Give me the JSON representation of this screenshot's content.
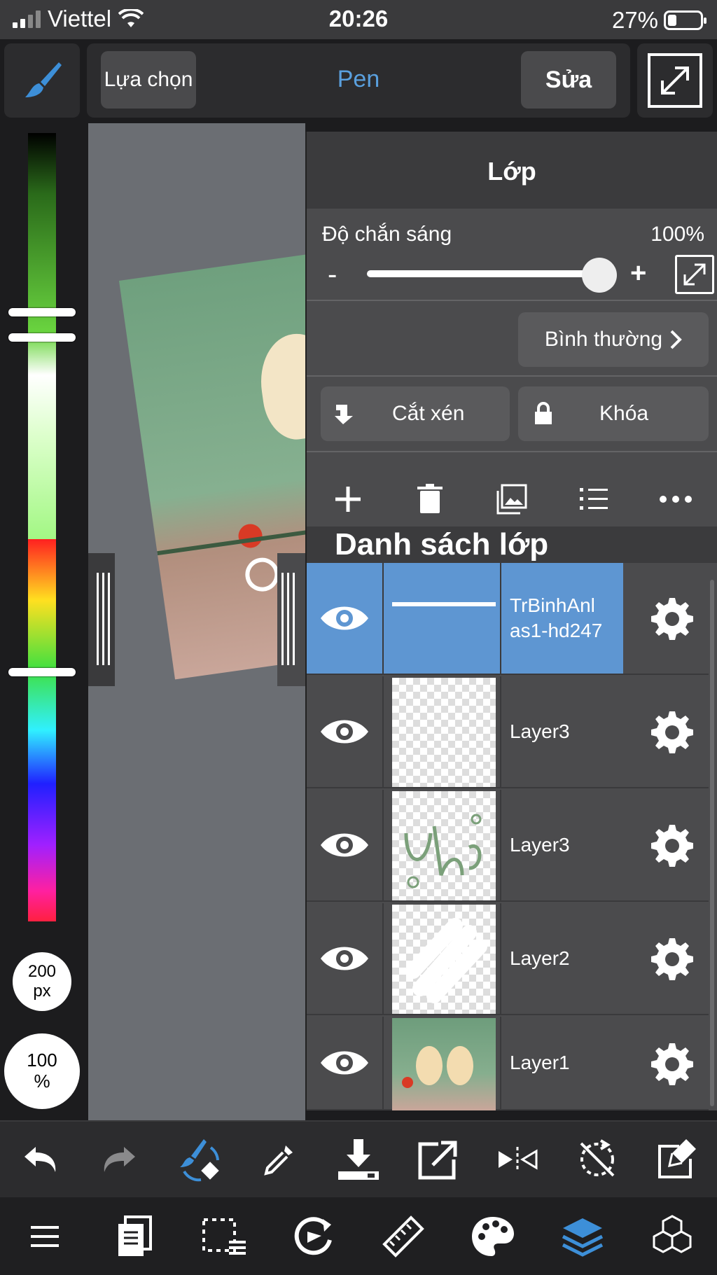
{
  "status_bar": {
    "carrier": "Viettel",
    "time": "20:26",
    "battery": "27%"
  },
  "toolbar": {
    "select_label": "Lựa chọn",
    "tool_name": "Pen",
    "edit_label": "Sửa"
  },
  "color_panel": {
    "brush_size_value": "200",
    "brush_size_unit": "px",
    "brush_opacity_value": "100",
    "brush_opacity_unit": "%"
  },
  "layer_panel": {
    "title": "Lớp",
    "opacity_label": "Độ chắn sáng",
    "opacity_value": "100%",
    "opacity_fraction": 1.0,
    "minus": "-",
    "plus": "+",
    "blend_mode": "Bình thường",
    "clipping_label": "Cắt xén",
    "lock_label": "Khóa",
    "list_header": "Danh sách lớp",
    "layers": [
      {
        "name": "TrBinhAnl as1-hd247",
        "selected": true
      },
      {
        "name": "Layer3",
        "selected": false
      },
      {
        "name": "Layer3",
        "selected": false
      },
      {
        "name": "Layer2",
        "selected": false
      },
      {
        "name": "Layer1",
        "selected": false
      }
    ]
  },
  "colors": {
    "accent": "#5aa0de",
    "selected_layer": "#5e96d2"
  },
  "icons": {
    "bottom_row_1": [
      "undo-icon",
      "redo-icon",
      "brush-eraser-swap-icon",
      "eyedropper-icon",
      "download-icon",
      "export-icon",
      "flip-icon",
      "rotate-lock-icon",
      "clear-icon"
    ],
    "bottom_row_2": [
      "menu-icon",
      "pages-icon",
      "selection-icon",
      "rotate-canvas-icon",
      "ruler-icon",
      "palette-icon",
      "layers-icon",
      "materials-icon"
    ]
  }
}
